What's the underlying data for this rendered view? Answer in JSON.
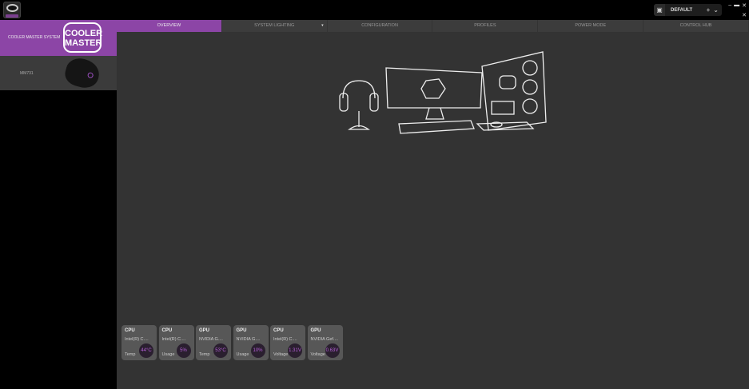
{
  "profile": {
    "name": "DEFAULT",
    "add": "+",
    "dropdown": "⌄",
    "image_icon": "▣"
  },
  "window": {
    "minimize": "–",
    "maximize": "▬",
    "close": "✕",
    "pin": "✕"
  },
  "sidebar": {
    "system_label": "COOLER MASTER SYSTEM",
    "logo_text_1": "COOLER",
    "logo_text_2": "MASTER",
    "devices": [
      {
        "name": "MM731"
      }
    ]
  },
  "tabs": [
    {
      "label": "OVERVIEW",
      "active": true
    },
    {
      "label": "SYSTEM LIGHTING",
      "dropdown": "▾"
    },
    {
      "label": "CONFIGURATION"
    },
    {
      "label": "PROFILES"
    },
    {
      "label": "POWER MODE"
    },
    {
      "label": "CONTROL HUB"
    }
  ],
  "monitors": [
    {
      "type": "CPU",
      "device": "Intel(R) C....",
      "metric": "Temp",
      "value": "44°C"
    },
    {
      "type": "CPU",
      "device": "Intel(R) C....",
      "metric": "Usage",
      "value": "5%"
    },
    {
      "type": "GPU",
      "device": "NVIDIA G....",
      "metric": "Temp",
      "value": "53°C"
    },
    {
      "type": "GPU",
      "device": "NVIDIA G....",
      "metric": "Usage",
      "value": "10%"
    },
    {
      "type": "CPU",
      "device": "Intel(R) C....",
      "metric": "Voltage",
      "value": "1.31V"
    },
    {
      "type": "GPU",
      "device": "NVIDIA Gef....",
      "metric": "Voltage",
      "value": "0.63V"
    }
  ],
  "colors": {
    "accent": "#8c45a6",
    "value": "#b560d8"
  }
}
